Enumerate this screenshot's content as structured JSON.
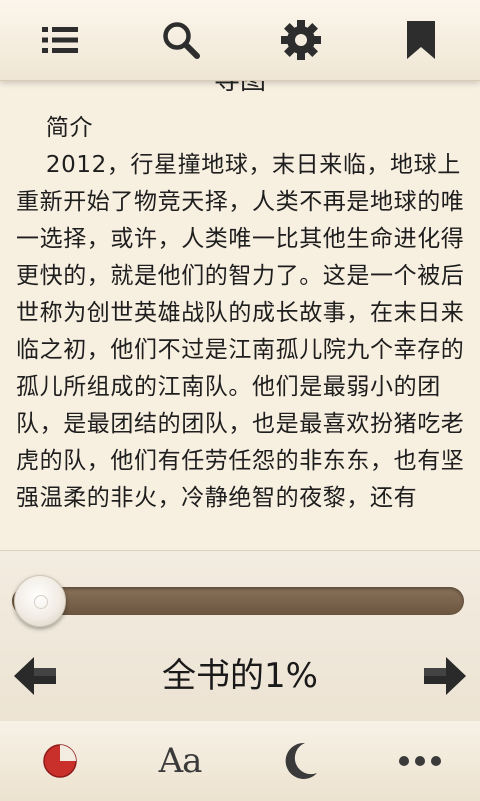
{
  "toolbar": {
    "icons": [
      "list-icon",
      "search-icon",
      "gear-icon",
      "bookmark-icon"
    ]
  },
  "reader": {
    "chapter_title": "导图",
    "intro_heading": "简介",
    "paragraph": "2012，行星撞地球，末日来临，地球上重新开始了物竞天择，人类不再是地球的唯一选择，或许，人类唯一比其他生命进化得更快的，就是他们的智力了。这是一个被后世称为创世英雄战队的成长故事，在末日来临之初，他们不过是江南孤儿院九个幸存的孤儿所组成的江南队。他们是最弱小的团队，是最团结的团队，也是最喜欢扮猪吃老虎的队，他们有任劳任怨的非东东，也有坚强温柔的非火，冷静绝智的夜黎，还有"
  },
  "progress": {
    "label": "全书的1%",
    "value_percent": 1
  },
  "bottom_bar": {
    "font_label": "Aa",
    "icons": [
      "brightness-icon",
      "font-size-icon",
      "night-mode-icon",
      "more-icon"
    ]
  },
  "colors": {
    "background": "#f7efe0",
    "slider_track": "#7a6249",
    "brightness_red": "#c9302c"
  }
}
